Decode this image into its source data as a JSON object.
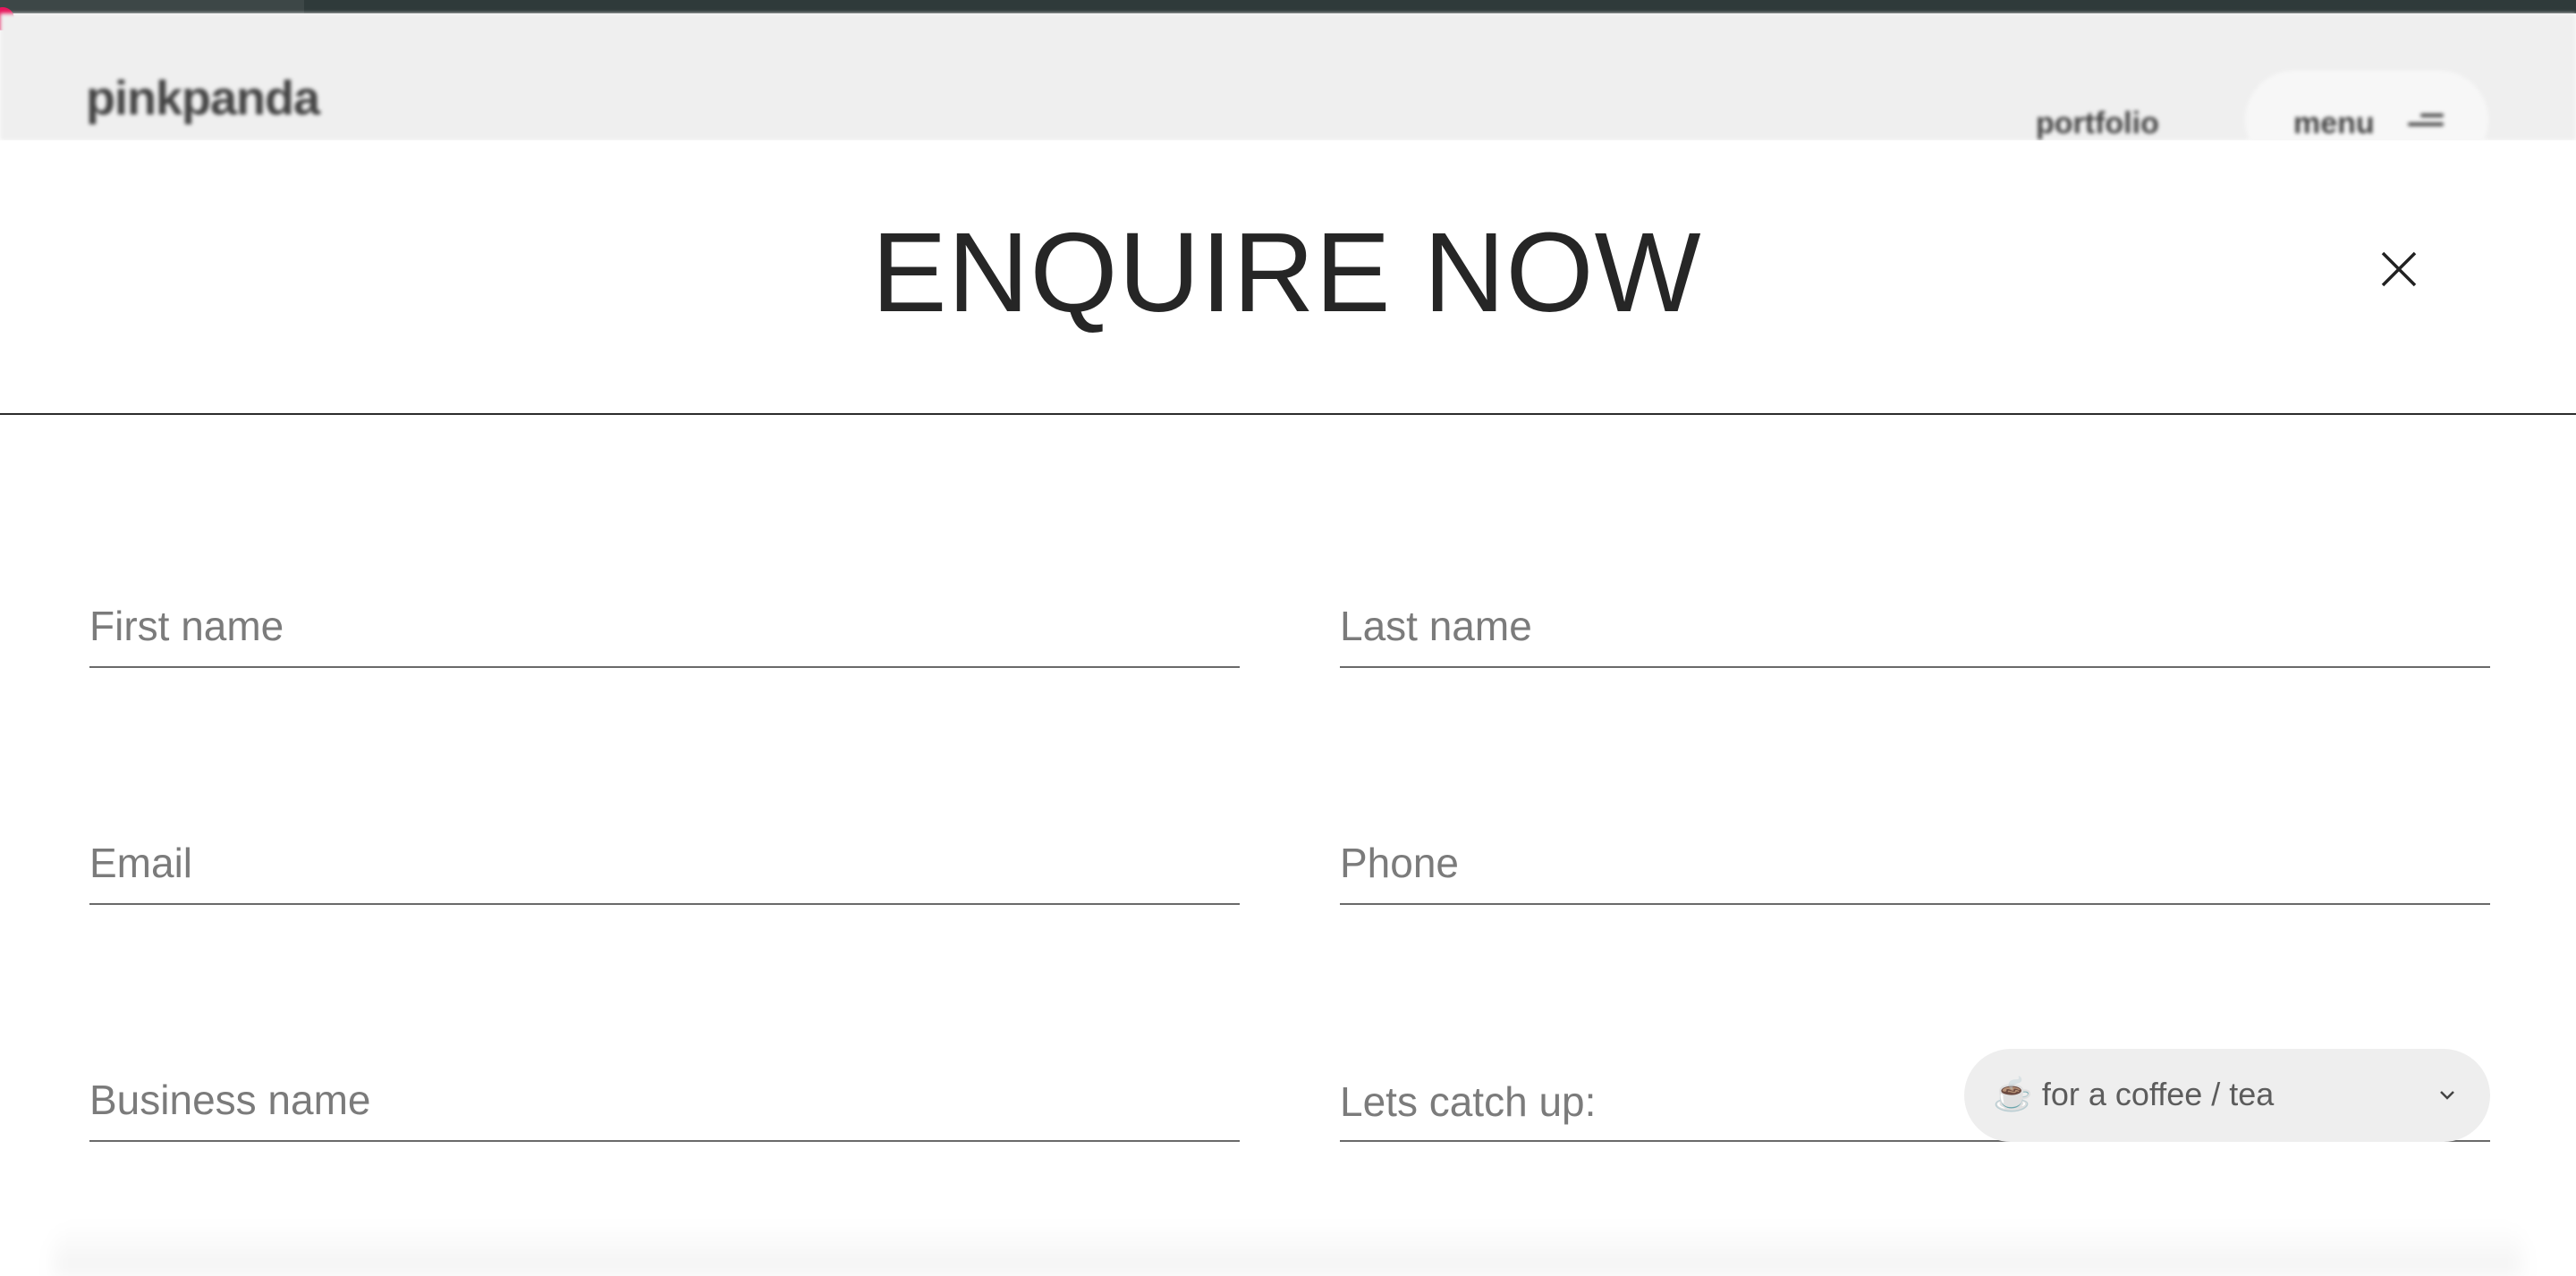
{
  "background": {
    "logo": "pinkpanda",
    "nav": {
      "portfolio": "portfolio",
      "menu": "menu"
    }
  },
  "modal": {
    "title": "ENQUIRE NOW",
    "close_icon": "close-icon"
  },
  "form": {
    "first_name_placeholder": "First name",
    "last_name_placeholder": "Last name",
    "email_placeholder": "Email",
    "phone_placeholder": "Phone",
    "business_placeholder": "Business name",
    "catch_up_label": "Lets catch up:",
    "catch_up_selected": "☕ for a coffee / tea",
    "catch_up_chevron_icon": "chevron-down-icon"
  },
  "colors": {
    "accent_dot": "#e8175d",
    "text_dark": "#262626",
    "placeholder": "#7b7b7b",
    "select_bg": "#eeeeee"
  }
}
